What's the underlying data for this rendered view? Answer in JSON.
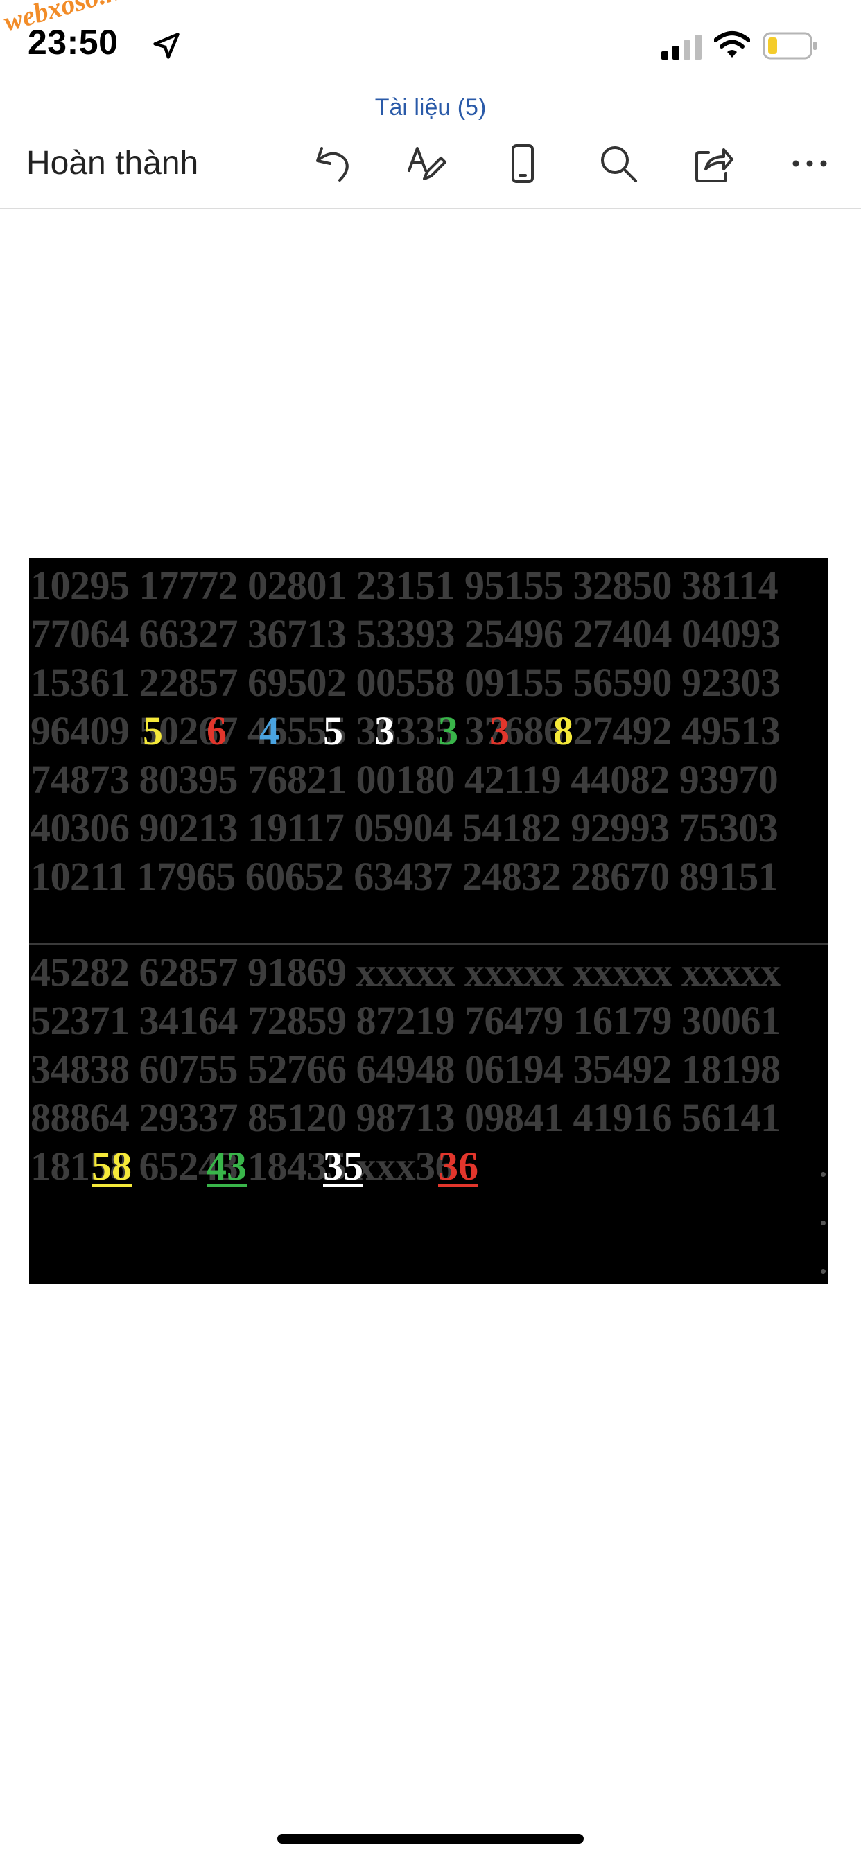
{
  "status_bar": {
    "time": "23:50",
    "watermark": "webxoso.net",
    "icons": [
      "location-arrow-icon",
      "cellular-signal-icon",
      "wifi-icon",
      "battery-low-icon"
    ]
  },
  "toolbar": {
    "document_title": "Tài liệu (5)",
    "done_label": "Hoàn thành",
    "icons": [
      "undo-icon",
      "pen-draw-icon",
      "mobile-view-icon",
      "search-icon",
      "share-icon",
      "more-icon"
    ]
  },
  "document": {
    "upper_rows": [
      "10295 17772 02801 23151 95155 32850 38114",
      "77064 66327 36713 53393 25496 27404 04093",
      "15361 22857 69502 00558 09155 56590 92303",
      "96409 50267 46555 36335 37686 27492 49513",
      "74873 80395 76821 00180 42119 44082 93970",
      "40306 90213 19117 05904 54182 92993 75303",
      "10211 17965 60652 63437 24832 28670 89151"
    ],
    "lower_rows": [
      "45282 62857 91869 xxxxx xxxxx xxxxx xxxxx",
      "52371 34164 72859 87219 76479 16179 30061",
      "34838 60755 52766 64948 06194 35492 18198",
      "88864 29337 85120 98713 09841 41916 56141",
      "18158 65243 18435 xxx36"
    ],
    "highlights_row4": [
      {
        "text": "5",
        "color": "#f5e93a"
      },
      {
        "text": "6",
        "color": "#e2362c"
      },
      {
        "text": "4",
        "color": "#4aa3e0"
      },
      {
        "text": "5",
        "color": "#ffffff"
      },
      {
        "text": "3",
        "color": "#ffffff"
      },
      {
        "text": "3",
        "color": "#39b54a"
      },
      {
        "text": "3",
        "color": "#e2362c"
      },
      {
        "text": "8",
        "color": "#f5e93a"
      }
    ],
    "highlights_row12": [
      {
        "text": "58",
        "color": "#f5e93a"
      },
      {
        "text": "43",
        "color": "#39b54a"
      },
      {
        "text": "35",
        "color": "#ffffff"
      },
      {
        "text": "36",
        "color": "#e2362c"
      }
    ]
  }
}
